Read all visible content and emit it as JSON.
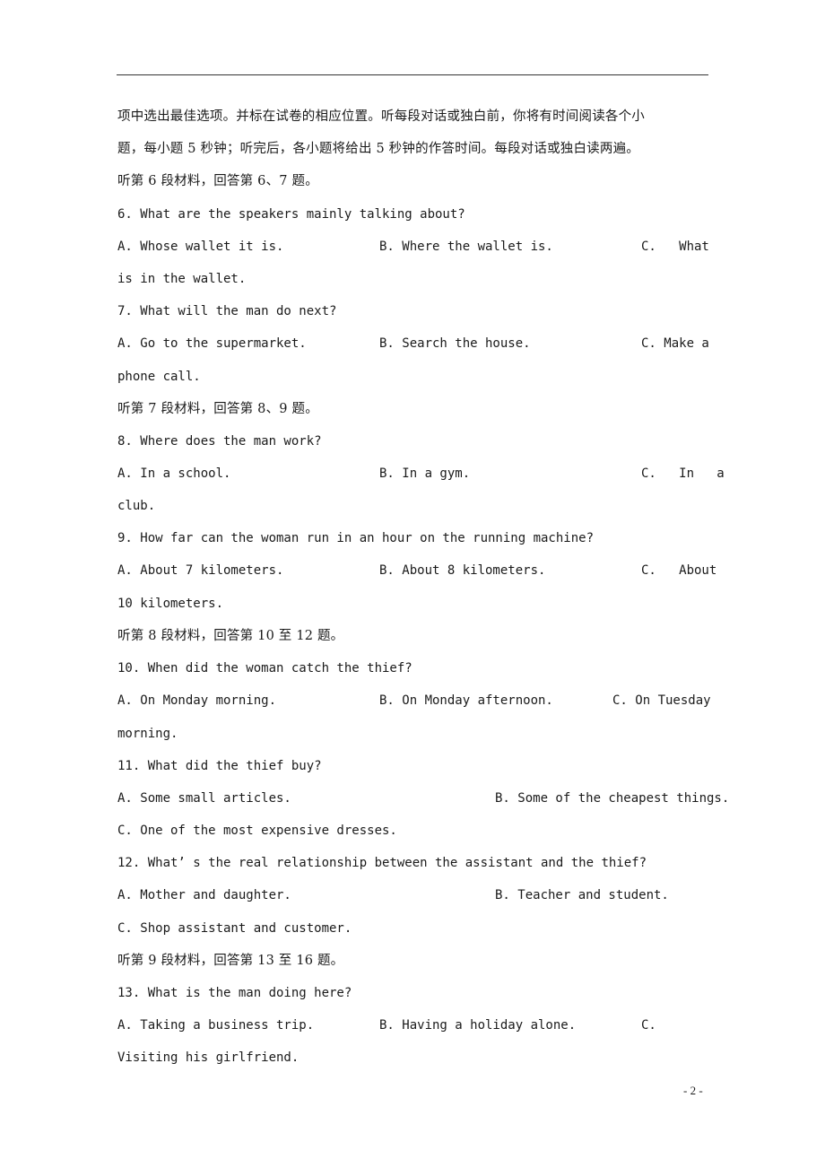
{
  "document": {
    "intro": [
      "项中选出最佳选项。并标在试卷的相应位置。听每段对话或独白前，你将有时间阅读各个小",
      "题，每小题 5 秒钟；听完后，各小题将给出 5 秒钟的作答时间。每段对话或独白读两遍。"
    ],
    "sections": [
      {
        "heading": "听第 6 段材料，回答第 6、7 题。",
        "questions": [
          {
            "stem": "6. What are the speakers mainly talking about?",
            "a": "A. Whose wallet it is.",
            "b": "B. Where the wallet is.",
            "c": "C.   What",
            "c_cont": "is in the wallet."
          },
          {
            "stem": "7. What will the man do next?",
            "a": "A. Go to the supermarket.",
            "b": "B. Search the house.",
            "c": "C. Make a",
            "c_cont": "phone call."
          }
        ]
      },
      {
        "heading": "听第 7 段材料，回答第 8、9 题。",
        "questions": [
          {
            "stem": "8. Where does the man work?",
            "a": "A. In a school.",
            "b": "B. In a gym.",
            "c": "C.   In   a",
            "c_cont": "club."
          },
          {
            "stem": "9. How far can the woman run in an hour on the running machine?",
            "a": "A. About 7 kilometers.",
            "b": "B. About 8 kilometers.",
            "c": "C.   About",
            "c_cont": "10 kilometers."
          }
        ]
      },
      {
        "heading": "听第 8 段材料，回答第 10 至 12 题。",
        "questions": [
          {
            "stem": "10. When did the woman catch the thief?",
            "a": "A. On Monday morning.",
            "b": "B. On Monday afternoon.",
            "c": "C. On Tuesday",
            "c_cont": "morning."
          },
          {
            "stem": "11. What did the thief buy?",
            "a": "A. Some small articles.",
            "b": "B. Some of the cheapest things.",
            "c": "C. One of the most expensive dresses."
          },
          {
            "stem": "12. What’ s the real relationship between the assistant and the thief?",
            "a": "A. Mother and daughter.",
            "b": "B. Teacher and student.",
            "c": "C. Shop assistant and customer."
          }
        ]
      },
      {
        "heading": "听第 9 段材料，回答第 13 至 16 题。",
        "questions": [
          {
            "stem": "13. What is the man doing here?",
            "a": "A. Taking a business trip.",
            "b": "B. Having a holiday alone.",
            "c": "C.",
            "c_cont": "Visiting his girlfriend."
          }
        ]
      }
    ],
    "page_number": "- 2 -"
  }
}
